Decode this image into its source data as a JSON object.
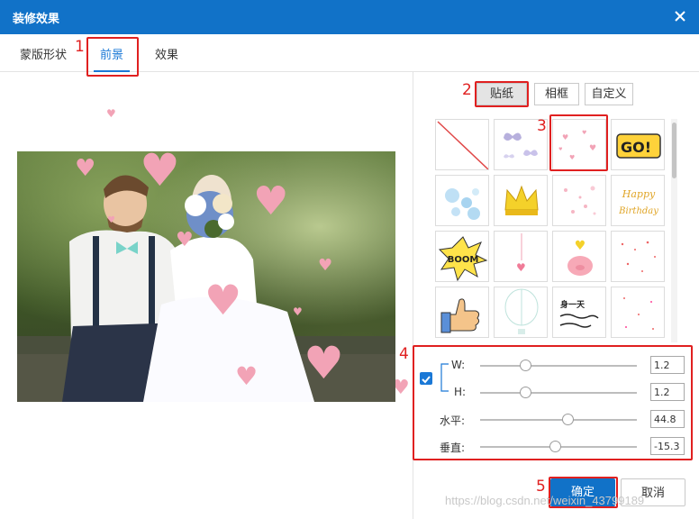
{
  "window": {
    "title": "装修效果"
  },
  "tabs": [
    {
      "label": "蒙版形状"
    },
    {
      "label": "前景"
    },
    {
      "label": "效果"
    }
  ],
  "sticker_tabs": [
    {
      "label": "贴纸"
    },
    {
      "label": "相框"
    },
    {
      "label": "自定义"
    }
  ],
  "stickers": [
    {
      "name": "none"
    },
    {
      "name": "butterflies"
    },
    {
      "name": "floating-hearts"
    },
    {
      "name": "go-text",
      "text": "GO!"
    },
    {
      "name": "bubbles"
    },
    {
      "name": "crown"
    },
    {
      "name": "pink-dots"
    },
    {
      "name": "happy-birthday",
      "text": "Happy Birthday"
    },
    {
      "name": "boom",
      "text": "BOOM"
    },
    {
      "name": "hanging-heart"
    },
    {
      "name": "pig-balloon"
    },
    {
      "name": "red-sparkles"
    },
    {
      "name": "thumbs-up"
    },
    {
      "name": "hot-air-balloon"
    },
    {
      "name": "handwritten-text",
      "text": "身一天"
    },
    {
      "name": "confetti"
    }
  ],
  "controls": {
    "width_label": "W:",
    "height_label": "H:",
    "horizontal_label": "水平:",
    "vertical_label": "垂直:",
    "width_value": "1.2",
    "height_value": "1.2",
    "horizontal_value": "44.8",
    "vertical_value": "-15.3",
    "width_level": 0.29,
    "height_level": 0.29,
    "horizontal_level": 0.56,
    "vertical_level": 0.48,
    "lock_ratio": true
  },
  "buttons": {
    "ok": "确定",
    "cancel": "取消"
  },
  "callouts": [
    "1",
    "2",
    "3",
    "4",
    "5"
  ],
  "watermark": "https://blog.csdn.net/weixin_43799189",
  "colors": {
    "titlebar": "#1172c8",
    "accent": "#1a78d6",
    "callout": "#e02020",
    "sticker_pink": "#f2a3b6"
  }
}
